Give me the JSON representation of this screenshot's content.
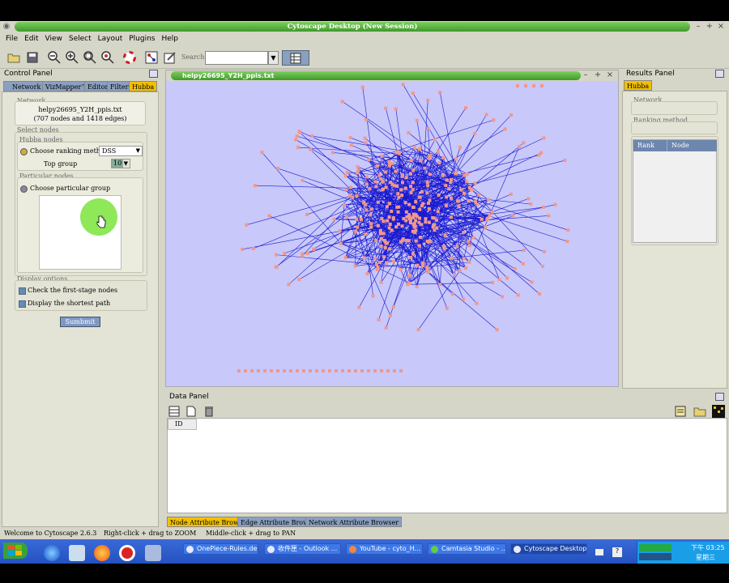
{
  "app": {
    "window_title": "Cytoscape Desktop (New Session)",
    "menus": [
      "File",
      "Edit",
      "View",
      "Select",
      "Layout",
      "Plugins",
      "Help"
    ],
    "search_label": "Search:",
    "search_value": ""
  },
  "control_panel": {
    "title": "Control Panel",
    "tabs": [
      "Network",
      "VizMapper™",
      "Editor",
      "Filters",
      "Hubba"
    ],
    "active_tab": "Hubba",
    "network_group_label": "Network",
    "network_name": "helpy26695_Y2H_ppis.txt",
    "network_stats": "(707 nodes and 1418 edges)",
    "select_nodes_label": "Select nodes",
    "hubba_nodes_label": "Hubba nodes",
    "ranking_option_label": "Choose ranking method",
    "ranking_method": "DSS",
    "top_group_label": "Top group",
    "top_group_value": "10",
    "particular_nodes_label": "Particular nodes",
    "particular_option_label": "Choose particular group",
    "display_options_label": "Display options",
    "check_first_stage": "Check the first-stage nodes",
    "display_shortest": "Display the shortest path",
    "submit_label": "Sumbmit"
  },
  "network_window": {
    "title": "helpy26695_Y2H_ppis.txt",
    "node_color": "#f0988c",
    "edge_color": "#1a1ad0",
    "background": "#c8c8fa"
  },
  "results_panel": {
    "title": "Results Panel",
    "tab": "Hubba",
    "network_label": "Network",
    "ranking_label": "Ranking method",
    "columns": [
      "Rank",
      "Node"
    ]
  },
  "data_panel": {
    "title": "Data Panel",
    "column": "ID",
    "tabs": [
      "Node Attribute Browser",
      "Edge Attribute Browser",
      "Network Attribute Browser"
    ]
  },
  "status": {
    "welcome": "Welcome to Cytoscape 2.6.3",
    "zoom_hint": "Right-click + drag  to  ZOOM",
    "pan_hint": "Middle-click + drag  to  PAN"
  },
  "taskbar": {
    "tasks": [
      "OnePiece-Rules.de...",
      "收件匣 - Outlook ...",
      "YouTube - cyto_H...",
      "Camtasia Studio - ...",
      "Cytoscape Desktop..."
    ],
    "clock_time": "下午 03:25",
    "clock_day": "星期三"
  }
}
